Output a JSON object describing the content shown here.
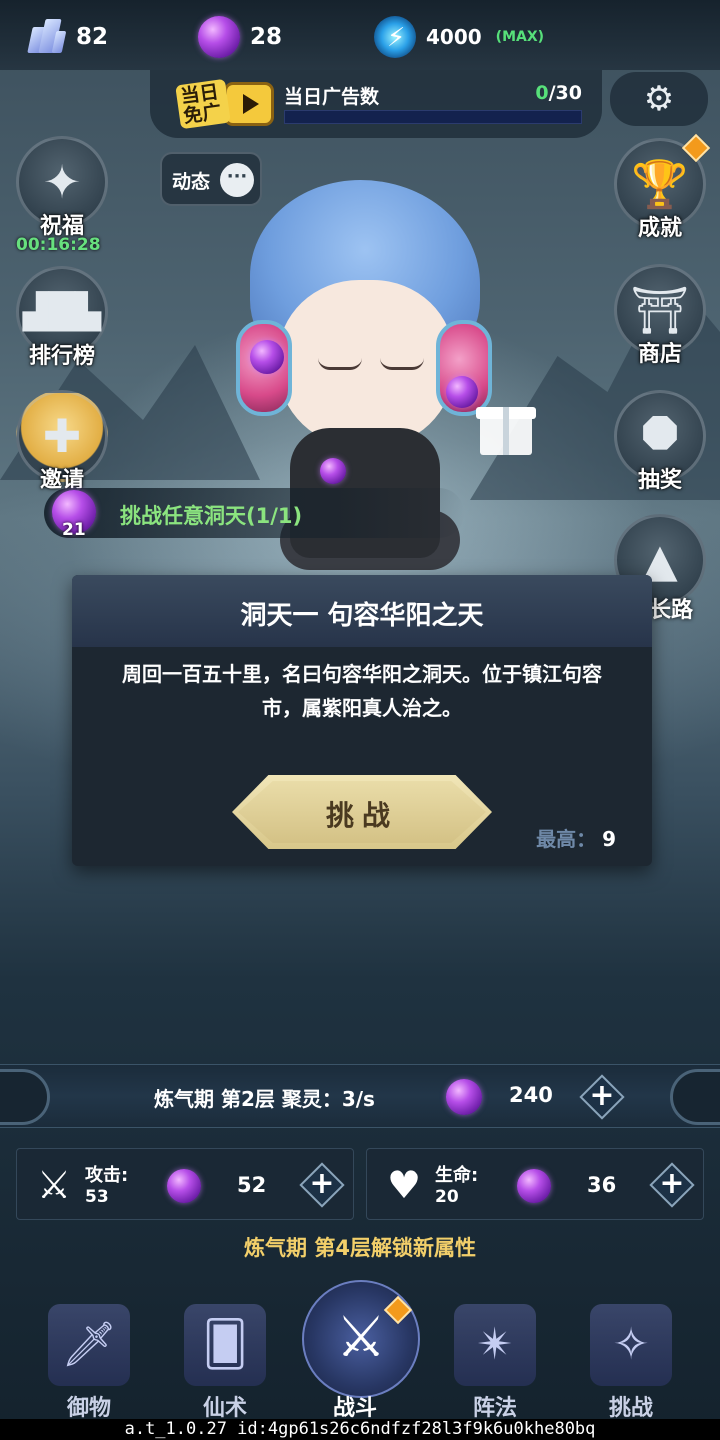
{
  "resources": {
    "crystal": "82",
    "spirit_orb": "28",
    "energy": "4000",
    "energy_max": "(MAX)"
  },
  "ad_bar": {
    "logo_text": "当日免广",
    "label": "当日广告数",
    "watched": "0",
    "total": "/30",
    "progress_fraction": 0.0
  },
  "left_buttons": [
    {
      "label": "祝福",
      "icon": "compass-star-icon"
    },
    {
      "label": "排行榜",
      "icon": "podium-icon"
    },
    {
      "label": "邀请",
      "icon": "invite-person-icon"
    }
  ],
  "blessing_timer": "00:16:28",
  "dynamic_button": {
    "label": "动态",
    "icon": "chat-bubble-icon"
  },
  "right_buttons": [
    {
      "label": "成就",
      "icon": "trophy-icon"
    },
    {
      "label": "商店",
      "icon": "shop-pavilion-icon"
    },
    {
      "label": "抽奖",
      "icon": "lottery-octagon-icon"
    },
    {
      "label": "成长路",
      "icon": "growth-mountain-icon"
    }
  ],
  "quest": {
    "orb_count": "21",
    "text": "挑战任意洞天(1/1)"
  },
  "dialog": {
    "title": "洞天一 句容华阳之天",
    "description": "周回一百五十里，名曰句容华阳之洞天。位于镇江句容市，属紫阳真人治之。",
    "challenge_label": "挑战",
    "best_label": "最高：",
    "best_value": "9"
  },
  "cultivation": {
    "text": "炼气期 第2层 聚灵：3/s",
    "orb_value": "240"
  },
  "stats": [
    {
      "name": "攻击:",
      "value": "53",
      "cost": "52",
      "icon": "sword-wings-icon"
    },
    {
      "name": "生命:",
      "value": "20",
      "cost": "36",
      "icon": "heart-icon"
    }
  ],
  "unlock_text": "炼气期 第4层解锁新属性",
  "nav": [
    {
      "label": "御物",
      "icon": "flying-sword-icon"
    },
    {
      "label": "仙术",
      "icon": "spell-card-icon"
    },
    {
      "label": "战斗",
      "icon": "crossed-swords-icon",
      "active": true
    },
    {
      "label": "阵法",
      "icon": "formation-shuriken-icon"
    },
    {
      "label": "挑战",
      "icon": "winged-challenge-icon"
    }
  ],
  "footer": "a.t_1.0.27 id:4gp61s26c6ndfzf28l3f9k6u0khe80bq",
  "colors": {
    "accent_green": "#57e07a",
    "gold_text": "#f2cf6a",
    "badge_orange": "#f39a1c"
  }
}
